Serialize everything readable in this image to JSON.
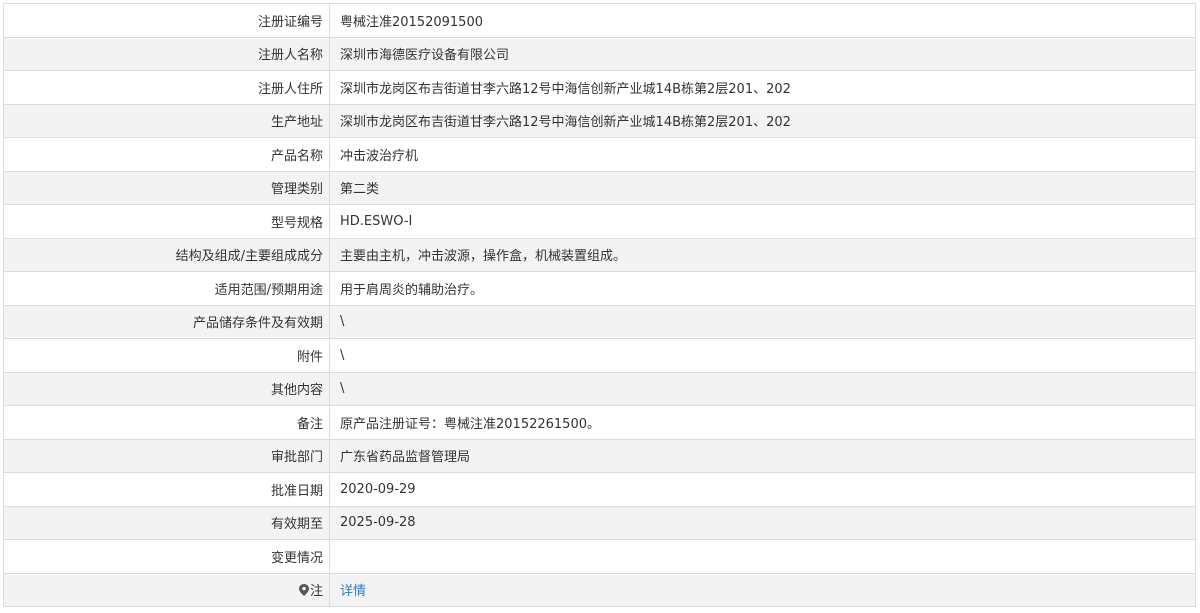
{
  "record": {
    "rows": [
      {
        "label": "注册证编号",
        "value": "粤械注准20152091500"
      },
      {
        "label": "注册人名称",
        "value": "深圳市海德医疗设备有限公司"
      },
      {
        "label": "注册人住所",
        "value": "深圳市龙岗区布吉街道甘李六路12号中海信创新产业城14B栋第2层201、202"
      },
      {
        "label": "生产地址",
        "value": "深圳市龙岗区布吉街道甘李六路12号中海信创新产业城14B栋第2层201、202"
      },
      {
        "label": "产品名称",
        "value": "冲击波治疗机"
      },
      {
        "label": "管理类别",
        "value": "第二类"
      },
      {
        "label": "型号规格",
        "value": "HD.ESWO-Ⅰ"
      },
      {
        "label": "结构及组成/主要组成成分",
        "value": "主要由主机，冲击波源，操作盒，机械装置组成。"
      },
      {
        "label": "适用范围/预期用途",
        "value": "用于肩周炎的辅助治疗。"
      },
      {
        "label": "产品储存条件及有效期",
        "value": "\\"
      },
      {
        "label": "附件",
        "value": "\\"
      },
      {
        "label": "其他内容",
        "value": "\\"
      },
      {
        "label": "备注",
        "value": "原产品注册证号：粤械注准20152261500。"
      },
      {
        "label": "审批部门",
        "value": "广东省药品监督管理局"
      },
      {
        "label": "批准日期",
        "value": "2020-09-29"
      },
      {
        "label": "有效期至",
        "value": "2025-09-28"
      },
      {
        "label": "变更情况",
        "value": ""
      }
    ],
    "note": {
      "label": "注",
      "icon": "location-pin-icon",
      "link_text": "详情"
    }
  },
  "colors": {
    "border": "#dcdcdc",
    "row_alt_bg": "#f3f3f3",
    "text": "#333333",
    "link": "#2e7fc0"
  }
}
